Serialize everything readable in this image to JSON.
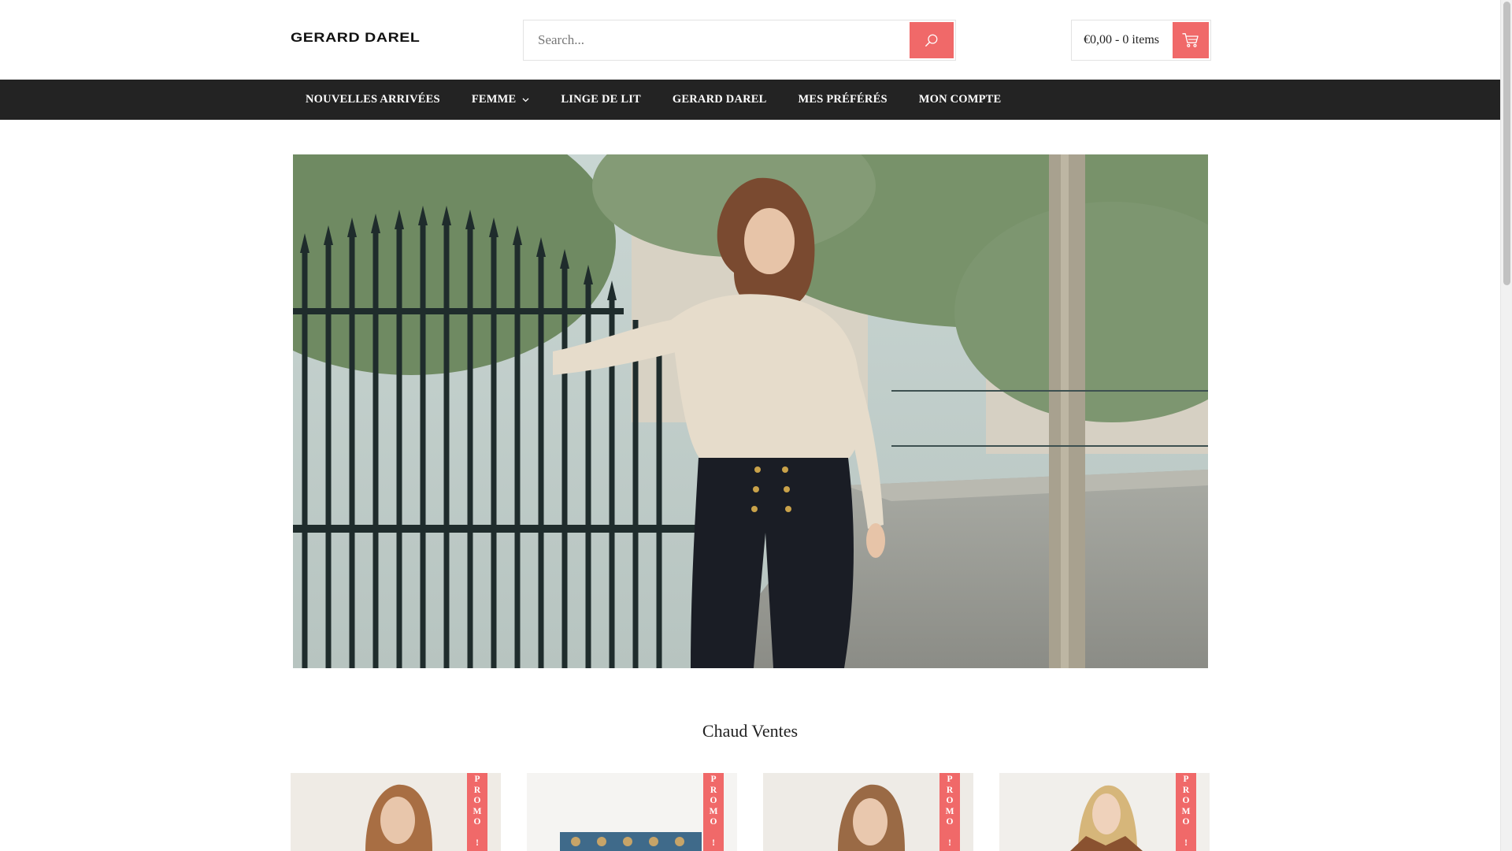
{
  "header": {
    "logo_text": "GERARD DAREL",
    "search": {
      "placeholder": "Search..."
    },
    "cart": {
      "summary": "€0,00 - 0 items"
    }
  },
  "nav": {
    "items": [
      {
        "label": "NOUVELLES ARRIVÉES",
        "has_dropdown": false
      },
      {
        "label": "FEMME",
        "has_dropdown": true
      },
      {
        "label": "LINGE DE LIT",
        "has_dropdown": false
      },
      {
        "label": "GERARD DAREL",
        "has_dropdown": false
      },
      {
        "label": "MES PRÉFÉRÉS",
        "has_dropdown": false
      },
      {
        "label": "MON COMPTE",
        "has_dropdown": false
      }
    ]
  },
  "section": {
    "title": "Chaud Ventes"
  },
  "products": [
    {
      "badge": "PROMO !"
    },
    {
      "badge": "PROMO !"
    },
    {
      "badge": "PROMO !"
    },
    {
      "badge": "PROMO !"
    }
  ],
  "colors": {
    "accent": "#f06969",
    "nav_background": "#232323",
    "nav_text": "#ffffff"
  },
  "icons": {
    "search_button": "search-icon",
    "cart_button": "cart-icon",
    "dropdown": "chevron-down-icon"
  }
}
